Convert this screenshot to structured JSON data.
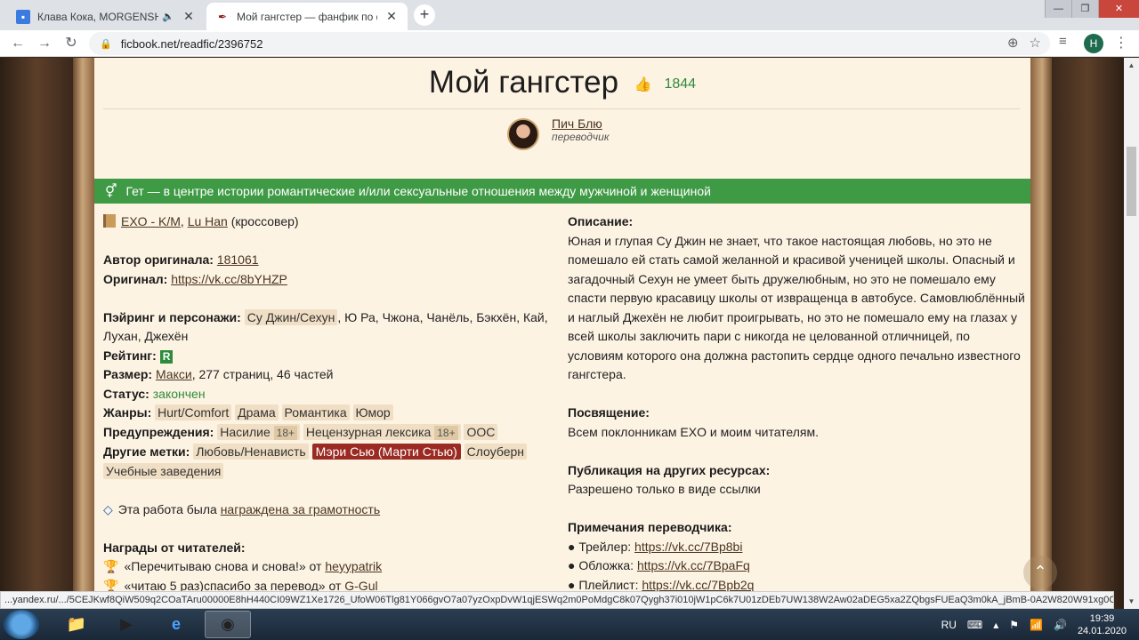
{
  "browser": {
    "tabs": [
      {
        "title": "Клава Кока, MORGENSHTERN",
        "favicon": "message-icon",
        "audio": true
      },
      {
        "title": "Мой гангстер — фанфик по фэнд",
        "favicon": "quill-icon",
        "active": true
      }
    ],
    "url": "ficbook.net/readfic/2396752",
    "profile_initial": "H",
    "status_url": "...yandex.ru/.../5CEJKwf8QiW509q2COaTAru00000E8hH440CI09WZ1Xe1726_UfoW06Tlg81Y066gvO7a07yzOxpDvW1qjESWq2m0PoMdgC8k07Qygh37i010jW1pC6k7U01zDEb7UW138W2Aw02aDEG5xa2ZQbgsFUEaQ3m0kA_jBmB-0A2W820W91xg0Cli..."
  },
  "fanfic": {
    "title": "Мой гангстер",
    "likes": "1844",
    "author_name": "Пич Блю",
    "author_role": "переводчик",
    "direction": "Гет — в центре истории романтические и/или сексуальные отношения между мужчиной и женщиной",
    "fandoms": {
      "first": "EXO - K/M",
      "second": "Lu Han",
      "suffix": "(кроссовер)"
    },
    "original_author_label": "Автор оригинала:",
    "original_author": "181061",
    "original_label": "Оригинал:",
    "original_link": "https://vk.cc/8bYHZP",
    "pairing_label": "Пэйринг и персонажи:",
    "pairing_tag": "Су Джин/Сехун",
    "pairing_rest": ", Ю Ра, Чжона, Чанёль, Бэкхён, Кай, Лухан, Джехён",
    "rating_label": "Рейтинг:",
    "rating": "R",
    "size_label": "Размер:",
    "size_link": "Макси",
    "size_rest": ", 277 страниц, 46 частей",
    "status_label": "Статус:",
    "status": "закончен",
    "genres_label": "Жанры:",
    "genres": [
      "Hurt/Comfort",
      "Драма",
      "Романтика",
      "Юмор"
    ],
    "warnings_label": "Предупреждения:",
    "warnings": [
      {
        "name": "Насилие",
        "age": "18+"
      },
      {
        "name": "Нецензурная лексика",
        "age": "18+"
      },
      {
        "name": "ООС"
      }
    ],
    "tags_label": "Другие метки:",
    "tags": [
      "Любовь/Ненависть",
      "Мэри Сью (Марти Стью)",
      "Слоуберн",
      "Учебные заведения"
    ],
    "award_text": "Эта работа была",
    "award_link": "награждена за грамотность",
    "rewards_label": "Награды от читателей:",
    "rewards": [
      {
        "text": "«Перечитываю снова и снова!» от",
        "user": "heyypatrik"
      },
      {
        "text": "«читаю 5 раз)спасибо за перевод» от",
        "user": "G-Gul"
      }
    ],
    "description_label": "Описание:",
    "description": "Юная и глупая Су Джин не знает, что такое настоящая любовь, но это не помешало ей стать самой желанной и красивой ученицей школы. Опасный и загадочный Сехун не умеет быть дружелюбным, но это не помешало ему спасти первую красавицу школы от извращенца в автобусе. Самовлюблённый и наглый Джехён не любит проигрывать, но это не помешало ему на глазах у всей школы заключить пари с никогда не целованной отличницей, по условиям которого она должна растопить сердце одного печально известного гангстера.",
    "dedication_label": "Посвящение:",
    "dedication": "Всем поклонникам EXO и моим читателям.",
    "publication_label": "Публикация на других ресурсах:",
    "publication": "Разрешено только в виде ссылки",
    "notes_label": "Примечания переводчика:",
    "notes": [
      {
        "label": "Трейлер:",
        "link": "https://vk.cc/7Bp8bi"
      },
      {
        "label": "Обложка:",
        "link": "https://vk.cc/7BpaFq"
      },
      {
        "label": "Плейлист:",
        "link": "https://vk.cc/7Bpb2q"
      }
    ]
  },
  "taskbar": {
    "lang": "RU",
    "time": "19:39",
    "date": "24.01.2020"
  },
  "colors": {
    "direction_bg": "#3f9a45",
    "paper_bg": "#fdf3e3",
    "tag_red": "#9b2a22",
    "rating_green": "#2e8b3c"
  }
}
